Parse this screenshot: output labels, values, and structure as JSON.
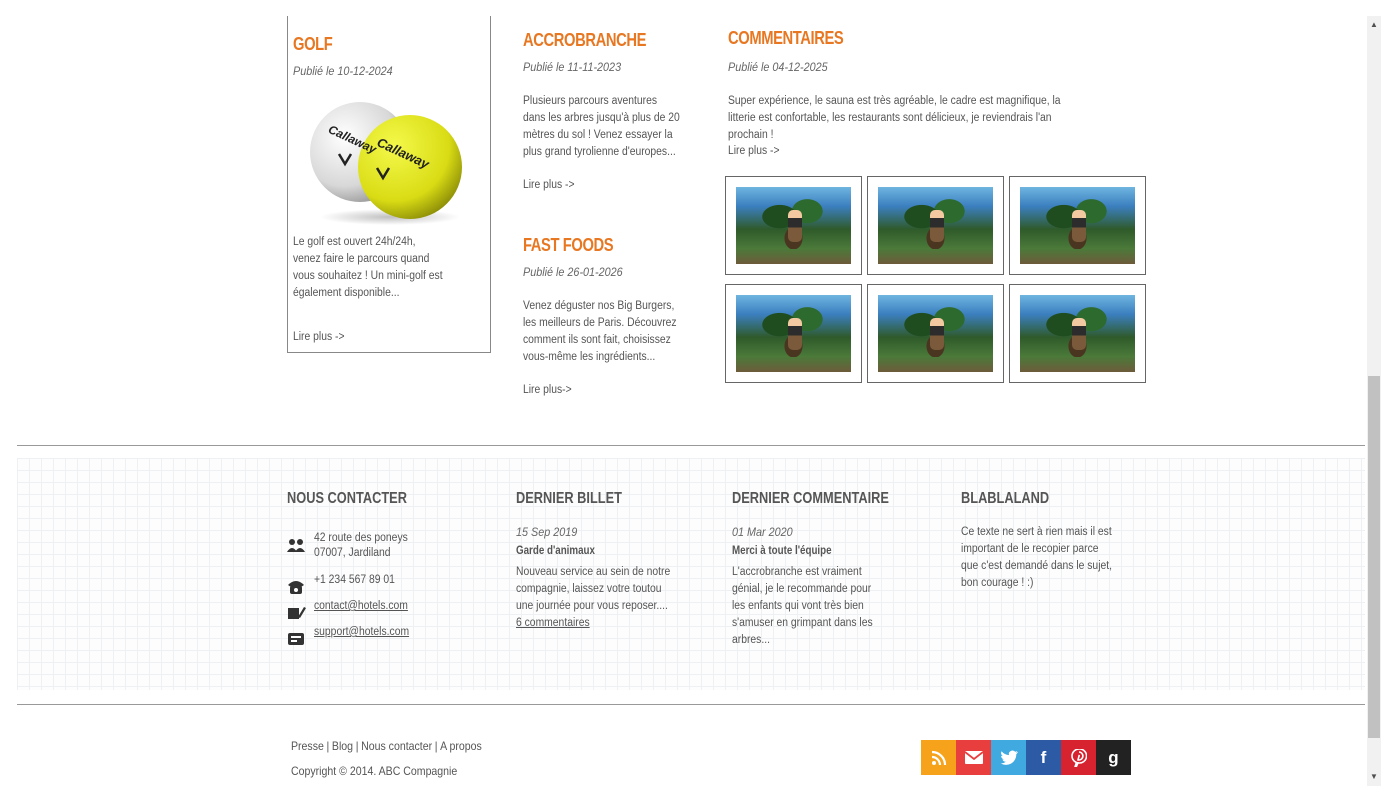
{
  "articles": {
    "golf": {
      "title": "GOLF",
      "date": "Publié le 10-12-2024",
      "body": "Le golf est ouvert 24h/24h, venez faire le parcours quand vous souhaitez ! Un mini-golf est également disponible...",
      "more": "Lire plus ->"
    },
    "accro": {
      "title": "ACCROBRANCHE",
      "date": "Publié le 11-11-2023",
      "body": "Plusieurs parcours aventures dans les arbres jusqu'à plus de 20 mètres du sol ! Venez essayer la plus grand tyrolienne d'europes...",
      "more": "Lire plus ->"
    },
    "fastfood": {
      "title": "FAST FOODS",
      "date": "Publié le 26-01-2026",
      "body": "Venez déguster nos Big Burgers, les meilleurs de Paris. Découvrez comment ils sont fait, choisissez vous-même les ingrédients...",
      "more": "Lire plus->"
    },
    "comments": {
      "title": "COMMENTAIRES",
      "date": "Publié le 04-12-2025",
      "body": "Super expérience, le sauna est très agréable, le cadre est magnifique, la litterie est confortable, les restaurants sont délicieux, je reviendrais l'an prochain !",
      "more": "Lire plus ->"
    }
  },
  "golf_ball_brand": "Callaway",
  "footer": {
    "contact": {
      "title": "NOUS CONTACTER",
      "address_line1": "42 route des poneys",
      "address_line2": "07007, Jardiland",
      "phone": "+1 234 567 89 01",
      "email1": "contact@hotels.com",
      "email2": "support@hotels.com"
    },
    "last_post": {
      "title": "DERNIER BILLET",
      "date": "15 Sep 2019",
      "heading": "Garde d'animaux",
      "body": "Nouveau service au sein de notre compagnie, laissez votre toutou une journée pour vous reposer....",
      "comments_link": "6 commentaires"
    },
    "last_comment": {
      "title": "DERNIER COMMENTAIRE",
      "date": "01 Mar 2020",
      "heading": "Merci à toute l'équipe",
      "body": "L'accrobranche est vraiment génial, je le recommande pour les enfants qui vont très bien s'amuser en grimpant dans les arbres..."
    },
    "blabla": {
      "title": "BLABLALAND",
      "body": "Ce texte ne sert à rien mais il est important de le recopier parce que c'est demandé dans le sujet, bon courage ! :)"
    }
  },
  "bottom": {
    "links": [
      "Presse",
      "Blog",
      "Nous contacter",
      "A propos"
    ],
    "copyright": "Copyright © 2014. ABC Compagnie"
  },
  "social": [
    {
      "name": "rss",
      "glyph": "⌁",
      "color": "#f7a21b"
    },
    {
      "name": "email",
      "glyph": "✉",
      "color": "#e83e3e"
    },
    {
      "name": "twitter",
      "glyph": "🐦",
      "color": "#3fa9e0"
    },
    {
      "name": "facebook",
      "glyph": "f",
      "color": "#2d5aa5"
    },
    {
      "name": "pinterest",
      "glyph": "℗",
      "color": "#d6232f"
    },
    {
      "name": "google",
      "glyph": "g",
      "color": "#222222"
    }
  ],
  "colors": {
    "accent": "#e87722"
  }
}
